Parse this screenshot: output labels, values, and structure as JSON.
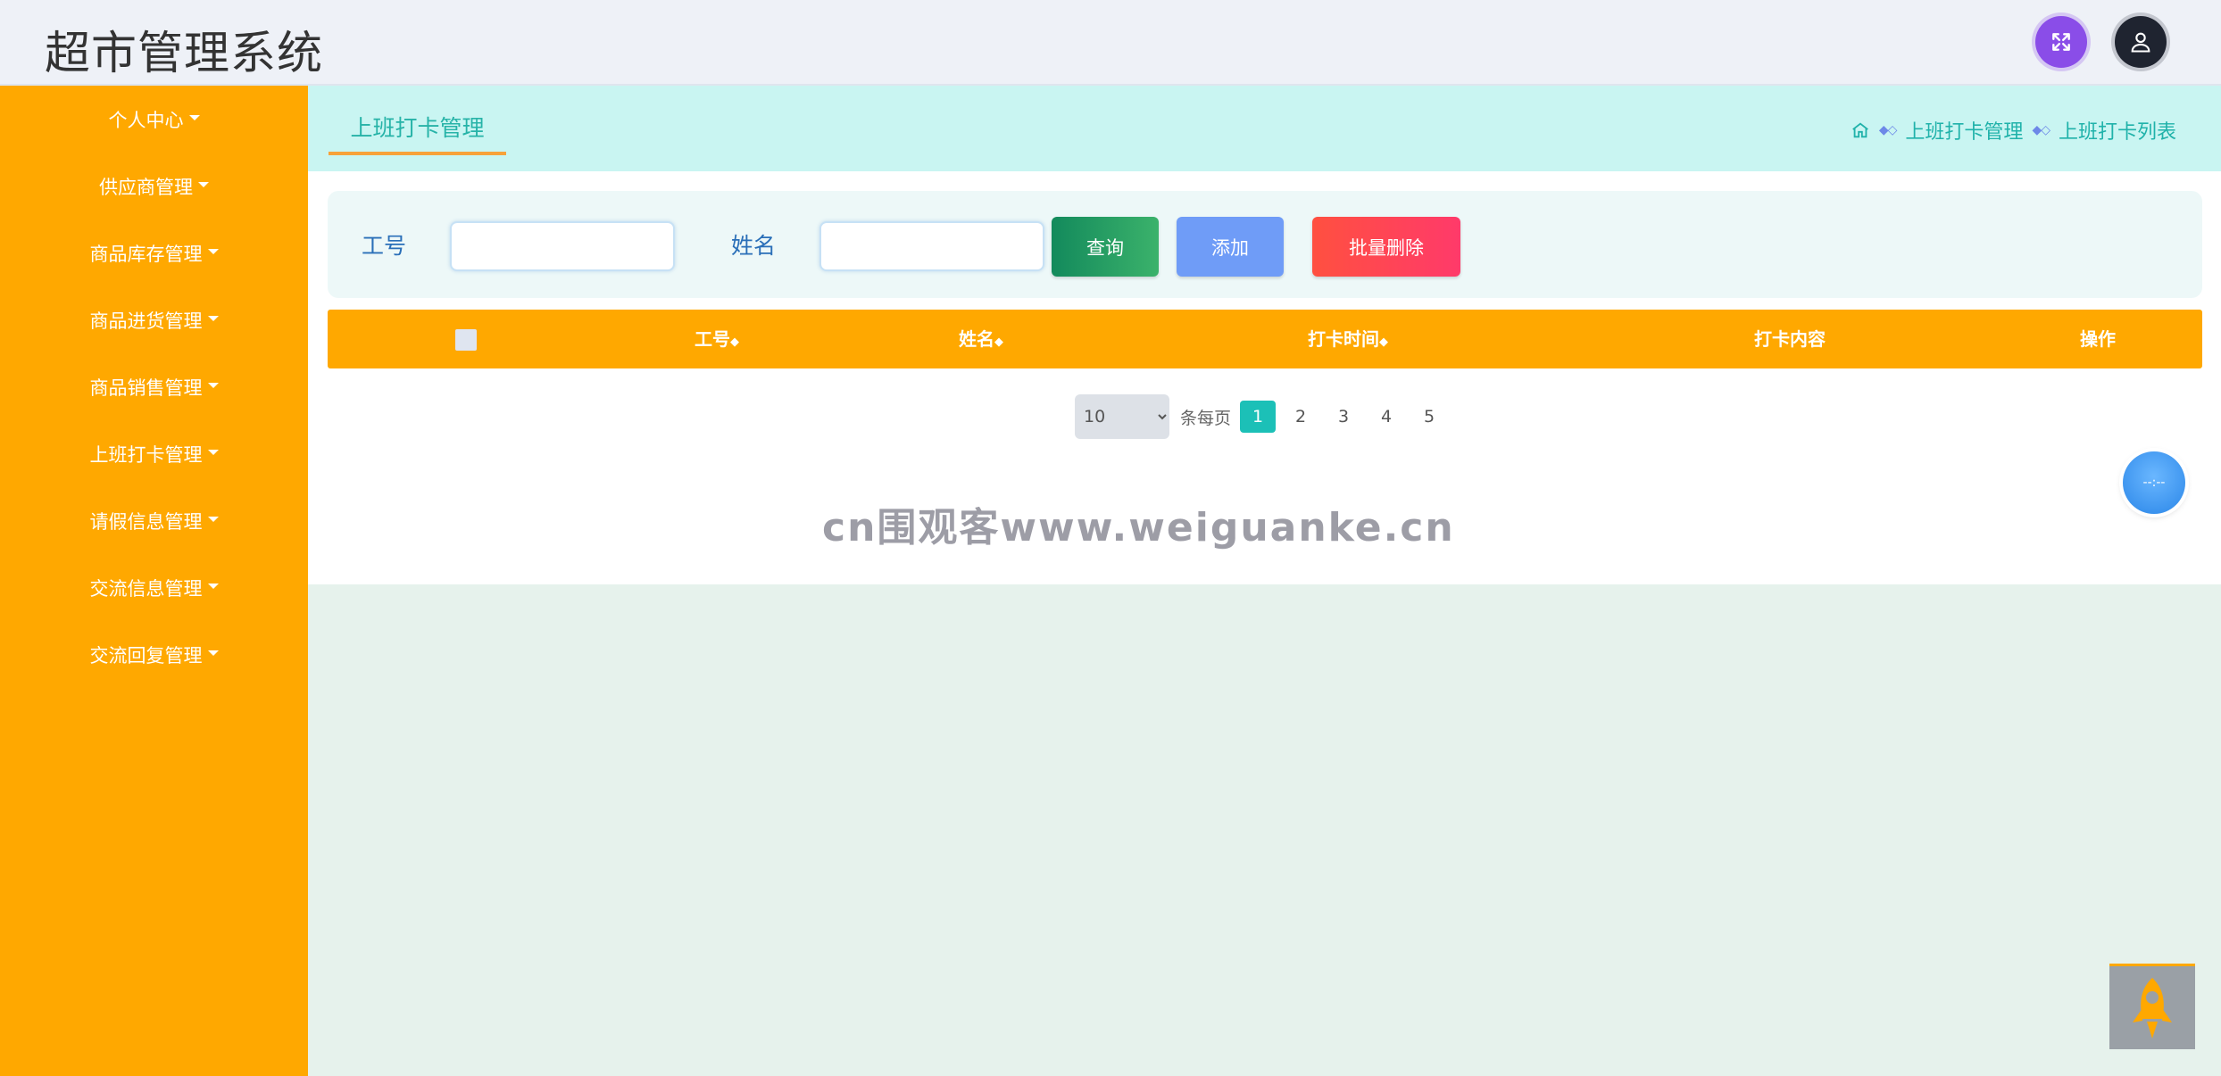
{
  "app": {
    "title": "超市管理系统"
  },
  "header": {
    "fullscreen_icon": "expand-icon",
    "user_icon": "user-icon"
  },
  "sidebar": {
    "items": [
      {
        "label": "个人中心"
      },
      {
        "label": "供应商管理"
      },
      {
        "label": "商品库存管理"
      },
      {
        "label": "商品进货管理"
      },
      {
        "label": "商品销售管理"
      },
      {
        "label": "上班打卡管理"
      },
      {
        "label": "请假信息管理"
      },
      {
        "label": "交流信息管理"
      },
      {
        "label": "交流回复管理"
      }
    ]
  },
  "tabs": {
    "active": "上班打卡管理"
  },
  "breadcrumb": {
    "level1": "上班打卡管理",
    "level2": "上班打卡列表"
  },
  "search": {
    "field1_label": "工号",
    "field1_value": "",
    "field2_label": "姓名",
    "field2_value": "",
    "query_label": "查询",
    "add_label": "添加",
    "bulk_delete_label": "批量删除"
  },
  "table": {
    "columns": [
      "工号",
      "姓名",
      "打卡时间",
      "打卡内容",
      "操作"
    ],
    "rows": []
  },
  "pagination": {
    "page_size": "10",
    "per_page_label": "条每页",
    "pages": [
      "1",
      "2",
      "3",
      "4",
      "5"
    ],
    "current": "1"
  },
  "watermark": "cn围观客www.weiguanke.cn",
  "clock": {
    "text": "--:--"
  },
  "colors": {
    "sidebar": "#ffa800",
    "table_header": "#ffa800",
    "tabbar": "#c9f5f2",
    "accent": "#20b2aa",
    "query": "#138a5c",
    "add": "#6f9cf7",
    "delete": "#ff4a4a"
  }
}
